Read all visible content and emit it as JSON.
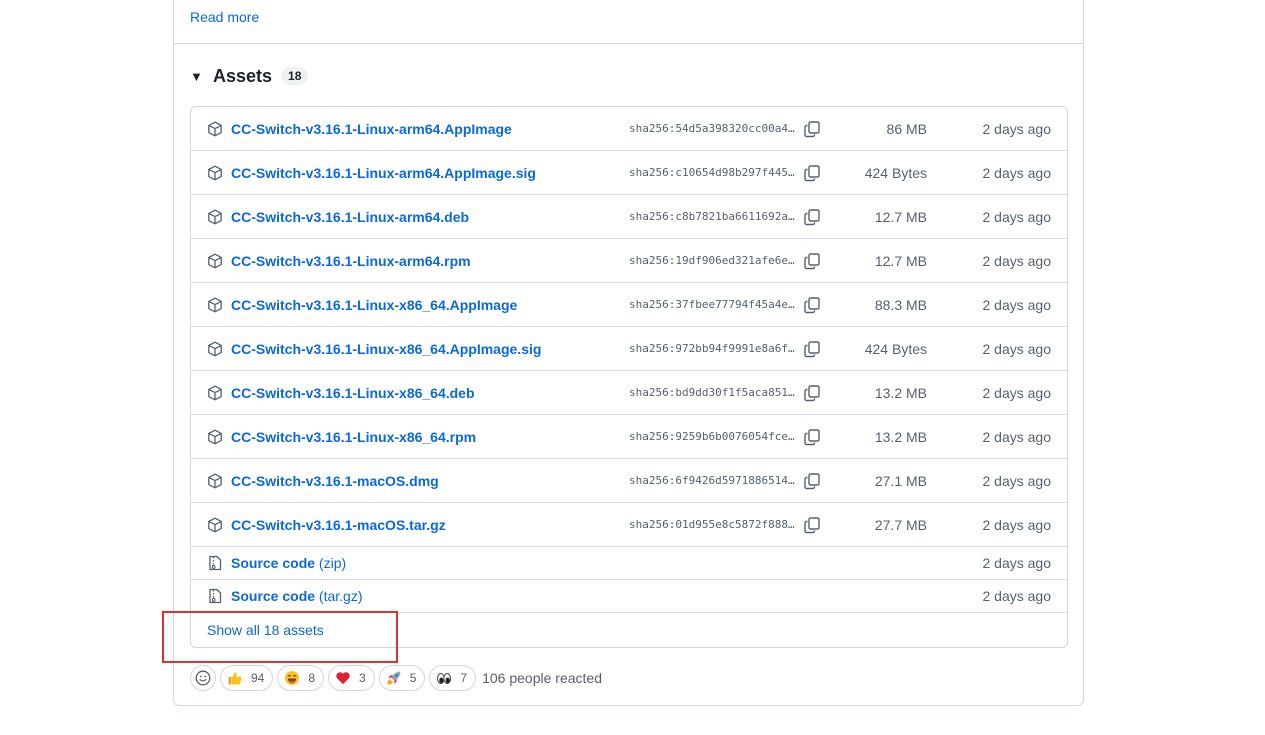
{
  "release": {
    "read_more": "Read more"
  },
  "assets": {
    "title": "Assets",
    "count": "18",
    "items": [
      {
        "name": "CC-Switch-v3.16.1-Linux-arm64.AppImage",
        "sha": "sha256:54d5a398320cc00a4…",
        "size": "86 MB",
        "date": "2 days ago"
      },
      {
        "name": "CC-Switch-v3.16.1-Linux-arm64.AppImage.sig",
        "sha": "sha256:c10654d98b297f445…",
        "size": "424 Bytes",
        "date": "2 days ago"
      },
      {
        "name": "CC-Switch-v3.16.1-Linux-arm64.deb",
        "sha": "sha256:c8b7821ba6611692a…",
        "size": "12.7 MB",
        "date": "2 days ago"
      },
      {
        "name": "CC-Switch-v3.16.1-Linux-arm64.rpm",
        "sha": "sha256:19df906ed321afe6e…",
        "size": "12.7 MB",
        "date": "2 days ago"
      },
      {
        "name": "CC-Switch-v3.16.1-Linux-x86_64.AppImage",
        "sha": "sha256:37fbee77794f45a4e…",
        "size": "88.3 MB",
        "date": "2 days ago"
      },
      {
        "name": "CC-Switch-v3.16.1-Linux-x86_64.AppImage.sig",
        "sha": "sha256:972bb94f9991e8a6f…",
        "size": "424 Bytes",
        "date": "2 days ago"
      },
      {
        "name": "CC-Switch-v3.16.1-Linux-x86_64.deb",
        "sha": "sha256:bd9dd30f1f5aca851…",
        "size": "13.2 MB",
        "date": "2 days ago"
      },
      {
        "name": "CC-Switch-v3.16.1-Linux-x86_64.rpm",
        "sha": "sha256:9259b6b0076054fce…",
        "size": "13.2 MB",
        "date": "2 days ago"
      },
      {
        "name": "CC-Switch-v3.16.1-macOS.dmg",
        "sha": "sha256:6f9426d5971886514…",
        "size": "27.1 MB",
        "date": "2 days ago"
      },
      {
        "name": "CC-Switch-v3.16.1-macOS.tar.gz",
        "sha": "sha256:01d955e8c5872f888…",
        "size": "27.7 MB",
        "date": "2 days ago"
      }
    ],
    "source": [
      {
        "name": "Source code",
        "suffix": "(zip)",
        "date": "2 days ago"
      },
      {
        "name": "Source code",
        "suffix": "(tar.gz)",
        "date": "2 days ago"
      }
    ],
    "show_all": "Show all 18 assets"
  },
  "reactions": {
    "items": [
      {
        "icon": "thumbs-up-icon",
        "count": "94"
      },
      {
        "icon": "laugh-icon",
        "count": "8"
      },
      {
        "icon": "heart-icon",
        "count": "3"
      },
      {
        "icon": "rocket-icon",
        "count": "5"
      },
      {
        "icon": "eyes-icon",
        "count": "7"
      }
    ],
    "summary": "106 people reacted"
  },
  "colors": {
    "link": "#0969da",
    "muted": "#57606a",
    "border": "#d0d7de",
    "highlight": "#e03131"
  }
}
